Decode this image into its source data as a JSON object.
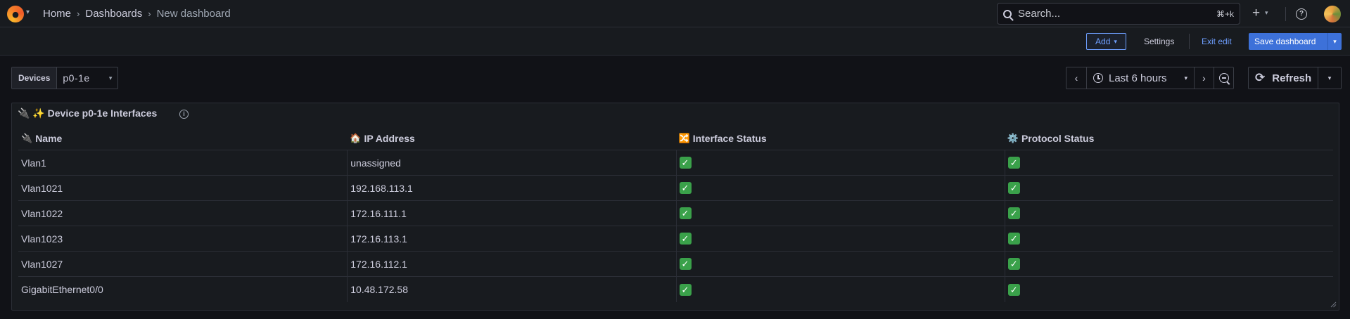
{
  "nav": {
    "breadcrumbs": [
      "Home",
      "Dashboards",
      "New dashboard"
    ],
    "search_placeholder": "Search...",
    "search_shortcut": "⌘+k",
    "new_icon": "+",
    "help_icon": "?"
  },
  "toolbar": {
    "add_label": "Add",
    "settings_label": "Settings",
    "exit_label": "Exit edit",
    "save_label": "Save dashboard"
  },
  "variables": {
    "label": "Devices",
    "value": "p0-1e"
  },
  "time": {
    "range_label": "Last 6 hours",
    "refresh_label": "Refresh"
  },
  "panel": {
    "title": "🔌 ✨ Device p0-1e Interfaces",
    "info_icon": "i",
    "columns": [
      {
        "emoji": "🔌",
        "label": "Name"
      },
      {
        "emoji": "🏠",
        "label": "IP Address"
      },
      {
        "emoji": "🔀",
        "label": "Interface Status"
      },
      {
        "emoji": "⚙️",
        "label": "Protocol Status"
      }
    ],
    "rows": [
      {
        "name": "Vlan1",
        "ip": "unassigned",
        "interface_status": "✓",
        "protocol_status": "✓"
      },
      {
        "name": "Vlan1021",
        "ip": "192.168.113.1",
        "interface_status": "✓",
        "protocol_status": "✓"
      },
      {
        "name": "Vlan1022",
        "ip": "172.16.111.1",
        "interface_status": "✓",
        "protocol_status": "✓"
      },
      {
        "name": "Vlan1023",
        "ip": "172.16.113.1",
        "interface_status": "✓",
        "protocol_status": "✓"
      },
      {
        "name": "Vlan1027",
        "ip": "172.16.112.1",
        "interface_status": "✓",
        "protocol_status": "✓"
      },
      {
        "name": "GigabitEthernet0/0",
        "ip": "10.48.172.58",
        "interface_status": "✓",
        "protocol_status": "✓"
      }
    ]
  },
  "colors": {
    "accent": "#3d71d9",
    "link": "#6e9fff",
    "status_ok": "#3aa14a",
    "background": "#111217",
    "panel": "#181b1f"
  }
}
